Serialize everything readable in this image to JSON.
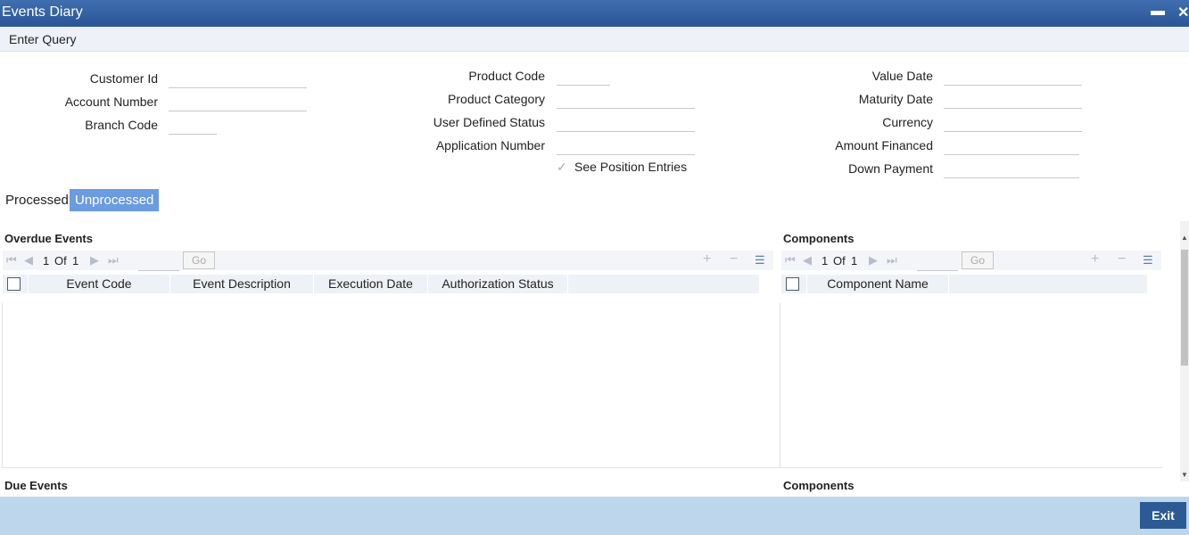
{
  "window": {
    "title": "Events Diary"
  },
  "menubar": {
    "enter_query": "Enter Query"
  },
  "form": {
    "customer_id": "Customer Id",
    "account_number": "Account Number",
    "branch_code": "Branch Code",
    "product_code": "Product Code",
    "product_category": "Product Category",
    "user_defined_status": "User Defined Status",
    "application_number": "Application Number",
    "see_position_entries": "See Position Entries",
    "value_date": "Value Date",
    "maturity_date": "Maturity Date",
    "currency": "Currency",
    "amount_financed": "Amount Financed",
    "down_payment": "Down Payment"
  },
  "tabs": {
    "processed": "Processed",
    "unprocessed": "Unprocessed"
  },
  "overdue": {
    "title": "Overdue Events",
    "page_current": "1",
    "page_of": "Of",
    "page_total": "1",
    "go": "Go",
    "columns": [
      "Event Code",
      "Event Description",
      "Execution Date",
      "Authorization Status"
    ]
  },
  "components_top": {
    "title": "Components",
    "page_current": "1",
    "page_of": "Of",
    "page_total": "1",
    "go": "Go",
    "columns": [
      "Component Name"
    ]
  },
  "due": {
    "title": "Due Events"
  },
  "components_bottom": {
    "title": "Components"
  },
  "footer": {
    "exit": "Exit"
  }
}
